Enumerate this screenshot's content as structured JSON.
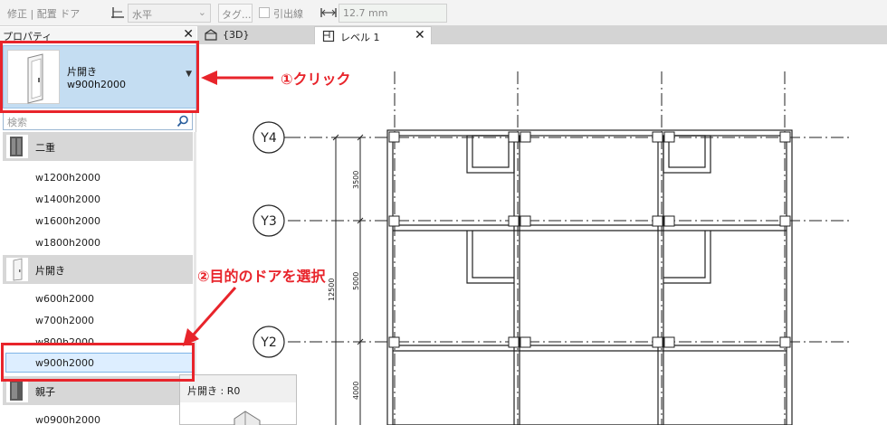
{
  "options_bar": {
    "mode": "修正 | 配置 ドア",
    "orientation_value": "水平",
    "tag_button": "タグ...",
    "leader_label": "引出線",
    "length_value": "12.7 mm"
  },
  "properties": {
    "title": "プロパティ",
    "close": "✕",
    "type_selector": {
      "family": "片開き",
      "type": "w900h2000"
    },
    "search_placeholder": "検索",
    "families": [
      {
        "name": "二重",
        "types": [
          "w1200h2000",
          "w1400h2000",
          "w1600h2000",
          "w1800h2000"
        ]
      },
      {
        "name": "片開き",
        "types": [
          "w600h2000",
          "w700h2000",
          "w800h2000",
          "w900h2000"
        ],
        "selected": "w900h2000"
      },
      {
        "name": "親子",
        "types": [
          "w0900h2000"
        ]
      }
    ]
  },
  "tooltip": {
    "text": "片開き : R0"
  },
  "tabs": [
    {
      "label": "{3D}"
    },
    {
      "label": "レベル 1",
      "close": "✕",
      "active": true
    }
  ],
  "plan": {
    "grid_labels": [
      "Y4",
      "Y3",
      "Y2"
    ],
    "dimensions": [
      "3500",
      "5000",
      "12500",
      "4000"
    ]
  },
  "annotations": {
    "step1": "①クリック",
    "step2": "②目的のドアを選択"
  },
  "colors": {
    "accent_red": "#e8242b",
    "selector_blue": "#c4ddf2",
    "selected_row": "#ddeeff"
  }
}
